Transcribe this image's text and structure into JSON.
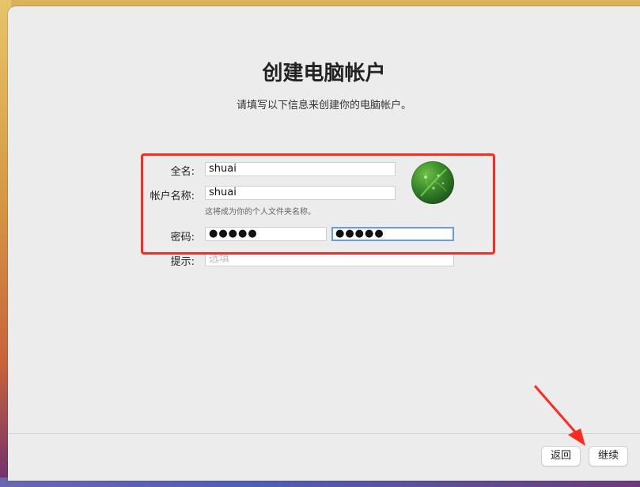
{
  "window": {
    "title": "创建电脑帐户",
    "subtitle": "请填写以下信息来创建你的电脑帐户。"
  },
  "form": {
    "full_name": {
      "label": "全名:",
      "value": "shuai"
    },
    "account_name": {
      "label": "帐户名称:",
      "value": "shuai",
      "hint": "这将成为你的个人文件夹名称。"
    },
    "password": {
      "label": "密码:",
      "value": "●●●●●",
      "verify_value": "●●●●●"
    },
    "hint": {
      "label": "提示:",
      "placeholder": "选填"
    }
  },
  "avatar": {
    "icon": "leaf-avatar-icon"
  },
  "footer": {
    "back_label": "返回",
    "continue_label": "继续"
  },
  "annotations": {
    "box_color": "#ff2a1f",
    "arrow_color": "#ff2a1f"
  }
}
